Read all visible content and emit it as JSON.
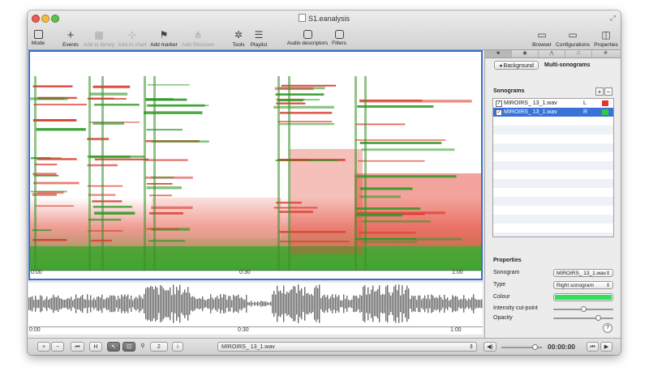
{
  "window": {
    "title": "S1.eanalysis"
  },
  "toolbar": {
    "mode": "Mode",
    "events": "Events",
    "add_library": "Add to library",
    "add_chart": "Add to chart",
    "add_marker": "Add marker",
    "add_structure": "Add Structure",
    "tools": "Tools",
    "playlist": "Playlist",
    "audio_descriptors": "Audio descriptors",
    "filters": "Filters",
    "browser": "Browser",
    "configurations": "Configurations",
    "properties": "Properties"
  },
  "sonogram_axis": {
    "t0": "0:00",
    "t1": "0:30",
    "t2": "1:00"
  },
  "wave_axis": {
    "t0": "0:00",
    "t1": "0:30",
    "t2": "1:00"
  },
  "bottom": {
    "plus": "+",
    "minus": "−",
    "page": "2",
    "info": "i",
    "file": "MIROIRS_ 13_1.wav",
    "time": "00:00:00"
  },
  "panel": {
    "back": "Background",
    "heading": "Multi-sonograms",
    "sonograms_header": "Sonograms",
    "add": "+",
    "remove": "−",
    "items": [
      {
        "name": "MIROIRS_ 13_1.wav",
        "channel": "L",
        "color": "#e8332a"
      },
      {
        "name": "MIROIRS_ 13_1.wav",
        "channel": "R",
        "color": "#2ecc40"
      }
    ],
    "properties_header": "Properties",
    "sonogram_label": "Sonogram",
    "sonogram_value": "MIROIRS_ 13_1.wav",
    "type_label": "Type",
    "type_value": "Right sonogram",
    "colour_label": "Colour",
    "colour_value": "#2ee05a",
    "cutpoint_label": "Intensity cut-point",
    "cutpoint_level": 0.5,
    "opacity_label": "Opacity",
    "opacity_level": 0.78,
    "help": "?"
  }
}
